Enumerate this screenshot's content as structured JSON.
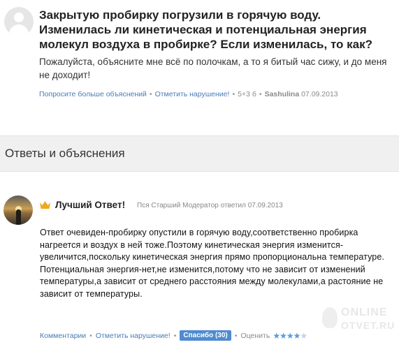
{
  "question": {
    "title": "Закрытую пробирку погрузили в горячую воду. Изменилась ли кинетическая и потенциальная энергия молекул воздуха в пробирке? Если изменилась, то как?",
    "text": "Пожалуйста, объясните мне всё по полочкам, а то я битый час сижу, и до меня не доходит!",
    "meta": {
      "ask_more": "Попросите больше объяснений",
      "report": "Отметить нарушение!",
      "points": "5+3 б",
      "author": "Sashulina",
      "date": "07.09.2013"
    }
  },
  "section": {
    "title": "Ответы и объяснения"
  },
  "answer": {
    "best_label": "Лучший Ответ!",
    "meta": "Пся Старший Модератор ответил 07.09.2013",
    "paragraph1": "Ответ очевиден-пробирку опустили в горячую воду,соответственно пробирка нагреется и воздух в ней тоже.Поэтому кинетическая энергия изменится-увеличится,поскольку кинетическая энергия прямо пропорциональна температуре.",
    "paragraph2": "Потенциальная энергия-нет,не изменится,потому что не зависит от изменений температуры,а зависит от среднего расстояния между молекулами,а растояние не зависит от температуры.",
    "footer": {
      "comments": "Комментарии",
      "report": "Отметить нарушение!",
      "thanks": "Спасибо (30)",
      "rate": "Оценить",
      "rating": 4
    }
  },
  "watermark": {
    "line1": "ONLINE",
    "line2": "OTVET.RU"
  },
  "colors": {
    "link": "#4a7bb7",
    "accent": "#4f8bd0",
    "crown": "#f0a81c"
  }
}
